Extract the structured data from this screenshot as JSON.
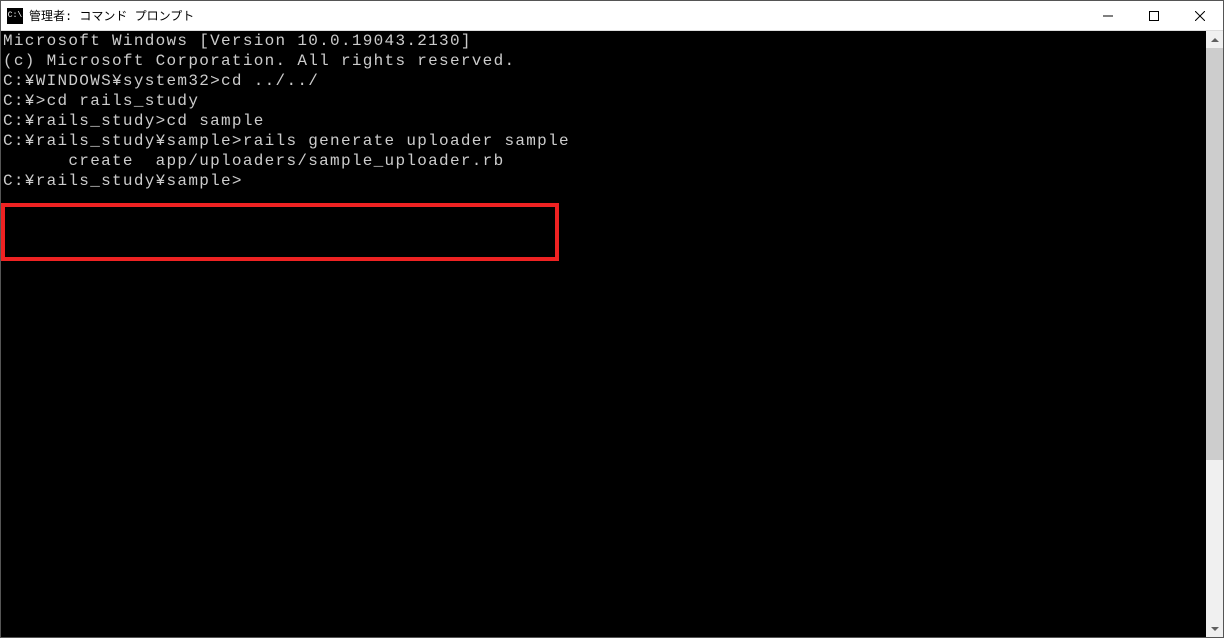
{
  "window": {
    "title": "管理者: コマンド プロンプト",
    "icon_text": "C:\\"
  },
  "terminal": {
    "lines": [
      "Microsoft Windows [Version 10.0.19043.2130]",
      "(c) Microsoft Corporation. All rights reserved.",
      "",
      "C:\\WINDOWS\\system32>cd ../../",
      "",
      "C:\\>cd rails_study",
      "",
      "C:\\rails_study>cd sample",
      "",
      "C:\\rails_study\\sample>rails generate uploader sample",
      "      create  app/uploaders/sample_uploader.rb",
      "",
      "C:\\rails_study\\sample>"
    ]
  }
}
